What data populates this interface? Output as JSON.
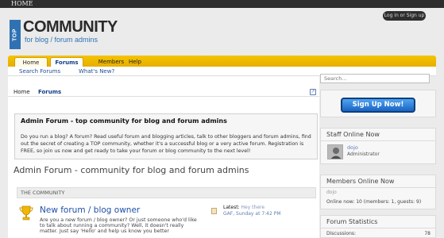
{
  "topbar": {
    "home": "HOME"
  },
  "header": {
    "logo_badge": "TOP",
    "logo_title": "COMMUNITY",
    "logo_subtitle": "for blog / forum admins",
    "login_label": "Log in or Sign up"
  },
  "nav": {
    "tabs": [
      "Home",
      "Forums",
      "Members",
      "Help"
    ],
    "sub": [
      "Search Forums",
      "What's New?"
    ]
  },
  "search": {
    "placeholder": "Search..."
  },
  "breadcrumb": {
    "home": "Home",
    "forums": "Forums"
  },
  "notice": {
    "title": "Admin Forum - top community for blog and forum admins",
    "body": "Do you run a blog? A forum? Read useful forum and blogging articles, talk to other bloggers and forum admins, find out the secret of creating a TOP community, whether it's a successful blog or a very active forum. Registration is FREE, so join us now and get ready to take your forum or blog community to the next level!"
  },
  "page_title": "Admin Forum - community for blog and forum admins",
  "category": {
    "title": "THE COMMUNITY"
  },
  "forum": {
    "title": "New forum / blog owner",
    "description": "Are you a new forum / blog owner? Or just someone who'd like to talk about running a community? Well, it doesn't really matter. Just say 'Hello' and help us know you better",
    "latest_label": "Latest:",
    "latest_thread": "Hey there",
    "latest_member": "GAF",
    "latest_time": ", Sunday at 7:42 PM"
  },
  "sidebar": {
    "signup_label": "Sign Up Now!",
    "staff_title": "Staff Online Now",
    "staff_name": "dojo",
    "staff_role": "Administrator",
    "members_title": "Members Online Now",
    "member_name": "dojo",
    "online_text": "Online now: 10 (members: 1, guests: 9)",
    "stats_title": "Forum Statistics",
    "discussions_label": "Discussions:",
    "discussions_value": "78"
  },
  "colors": {
    "accent": "#f4c400",
    "link": "#1f4fa8",
    "brand": "#2f72b3"
  },
  "icons": [
    "trophy-icon",
    "document-icon",
    "link-icon",
    "avatar"
  ]
}
